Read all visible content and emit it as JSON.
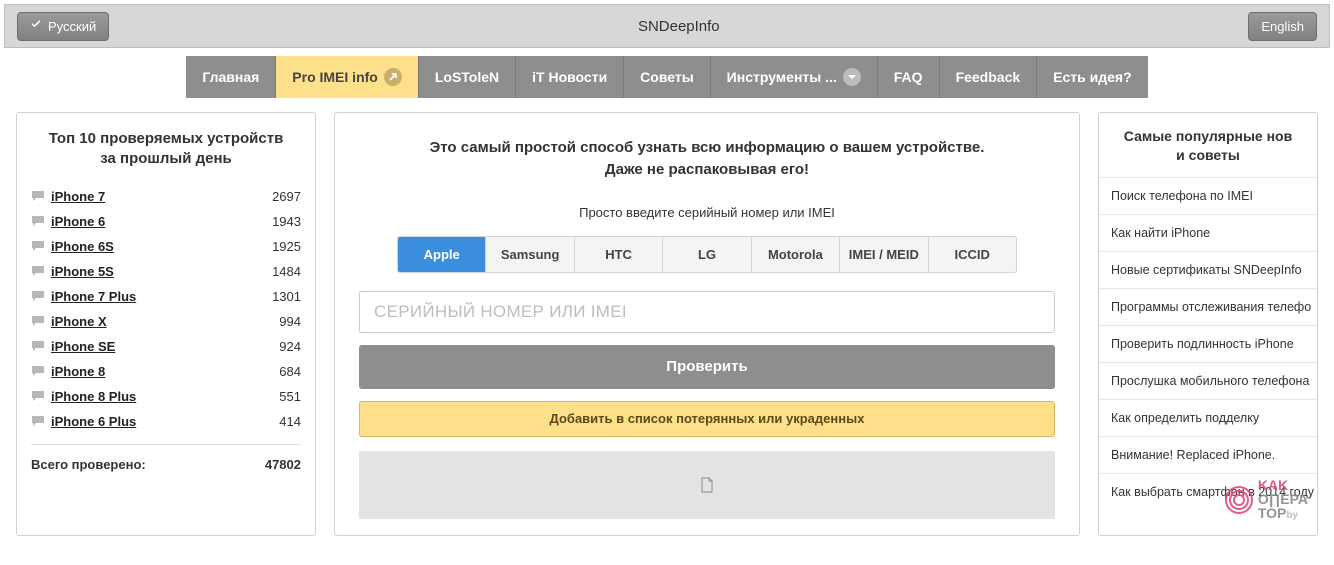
{
  "topbar": {
    "lang_ru": "Русский",
    "lang_en": "English",
    "title": "SNDeepInfo"
  },
  "nav": [
    {
      "label": "Главная"
    },
    {
      "label": "Pro IMEI info",
      "active": true,
      "icon": "external"
    },
    {
      "label": "LoSToleN"
    },
    {
      "label": "iT Новости"
    },
    {
      "label": "Советы"
    },
    {
      "label": "Инструменты ...",
      "icon": "chevron"
    },
    {
      "label": "FAQ"
    },
    {
      "label": "Feedback"
    },
    {
      "label": "Есть идея?"
    }
  ],
  "left": {
    "title1": "Топ 10 проверяемых устройств",
    "title2": "за прошлый день",
    "devices": [
      {
        "name": "iPhone 7",
        "count": 2697
      },
      {
        "name": "iPhone 6",
        "count": 1943
      },
      {
        "name": "iPhone 6S",
        "count": 1925
      },
      {
        "name": "iPhone 5S",
        "count": 1484
      },
      {
        "name": "iPhone 7 Plus",
        "count": 1301
      },
      {
        "name": "iPhone X",
        "count": 994
      },
      {
        "name": "iPhone SE",
        "count": 924
      },
      {
        "name": "iPhone 8",
        "count": 684
      },
      {
        "name": "iPhone 8 Plus",
        "count": 551
      },
      {
        "name": "iPhone 6 Plus",
        "count": 414
      }
    ],
    "total_label": "Всего проверено:",
    "total_value": 47802
  },
  "center": {
    "headline1": "Это самый простой способ узнать всю информацию о вашем устройстве.",
    "headline2": "Даже не распаковывая его!",
    "sub": "Просто введите серийный номер или IMEI",
    "brands": [
      "Apple",
      "Samsung",
      "HTC",
      "LG",
      "Motorola",
      "IMEI / MEID",
      "ICCID"
    ],
    "brand_active": 0,
    "input_placeholder": "СЕРИЙНЫЙ НОМЕР ИЛИ IMEI",
    "check_label": "Проверить",
    "lost_label": "Добавить в список потерянных или украденных"
  },
  "right": {
    "title1": "Самые популярные нов",
    "title2": "и советы",
    "items": [
      "Поиск телефона по IMEI",
      "Как найти iPhone",
      "Новые сертификаты SNDeepInfo",
      "Программы отслеживания телефо",
      "Проверить подлинность iPhone",
      "Прослушка мобильного телефона",
      "Как определить подделку",
      "Внимание! Replaced iPhone.",
      "Как выбрать смартфон в 2014 году"
    ]
  },
  "watermark": {
    "t1": "KAK",
    "t2": "O∏EPA",
    "t3": "TOP",
    "by": "by"
  }
}
